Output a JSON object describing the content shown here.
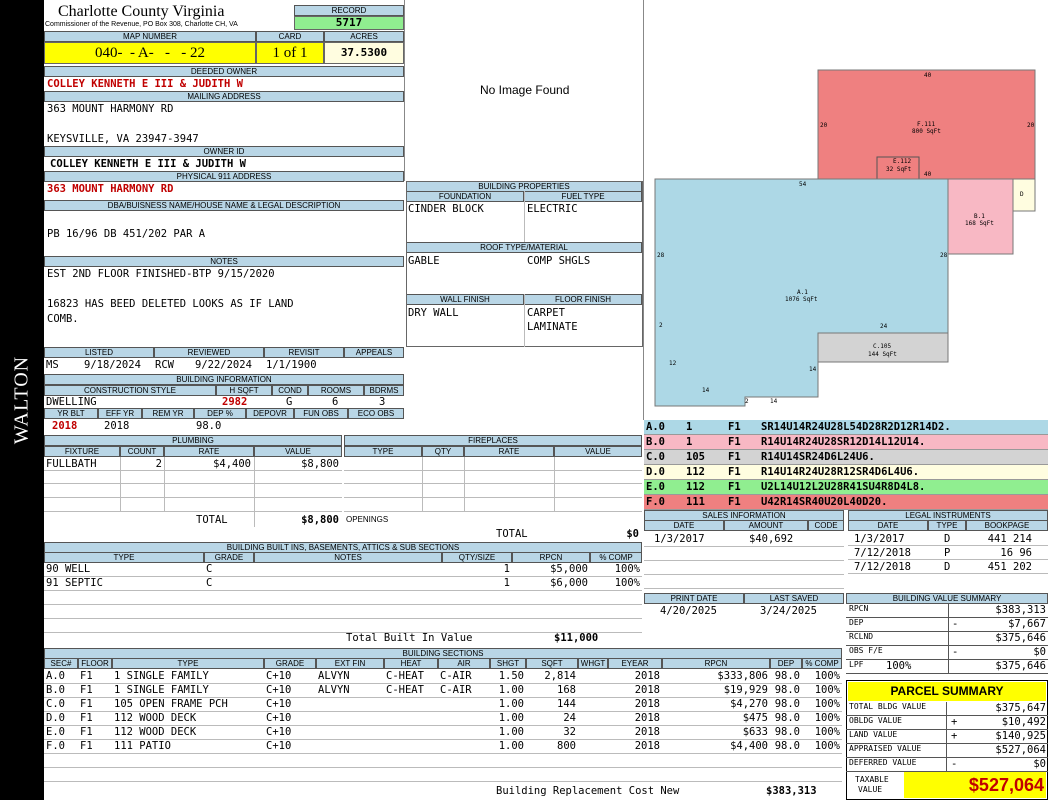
{
  "side_label": "WALTON",
  "header": {
    "county": "Charlotte County Virginia",
    "commissioner": "Commissioner of the Revenue, PO Box 308, Charlotte CH, VA",
    "record_label": "RECORD",
    "record": "5717",
    "map_label": "MAP NUMBER",
    "map_number": "040-  - A-   -   - 22",
    "card_label": "CARD",
    "card": "1 of 1",
    "acres_label": "ACRES",
    "acres": "37.5300"
  },
  "owner": {
    "deeded_label": "DEEDED OWNER",
    "deeded": "COLLEY KENNETH E III & JUDITH W",
    "mailing_label": "MAILING ADDRESS",
    "mail1": "363 MOUNT HARMONY RD",
    "mail2": "KEYSVILLE, VA 23947-3947",
    "owner_id_label": "OWNER ID",
    "owner_id": "COLLEY KENNETH E III & JUDITH W",
    "physical_label": "PHYSICAL 911 ADDRESS",
    "physical": "363 MOUNT HARMONY RD"
  },
  "dba": {
    "label": "DBA/BUISNESS NAME/HOUSE NAME & LEGAL DESCRIPTION",
    "text": "PB 16/96 DB 451/202 PAR A"
  },
  "notes": {
    "label": "NOTES",
    "line1": "EST 2ND FLOOR FINISHED-BTP 9/15/2020",
    "line2": "16823 HAS BEED DELETED LOOKS AS IF LAND",
    "line3": "COMB."
  },
  "listing": {
    "listed_label": "LISTED",
    "reviewed_label": "REVIEWED",
    "revisit_label": "REVISIT",
    "appeals_label": "APPEALS",
    "listed_by": "MS",
    "listed": "9/18/2024",
    "reviewed_by": "RCW",
    "reviewed": "9/22/2024",
    "revisit": "1/1/1900"
  },
  "bldg_info": {
    "label": "BUILDING INFORMATION",
    "cs_label": "CONSTRUCTION STYLE",
    "hsqft_label": "H SQFT",
    "cond_label": "COND",
    "rooms_label": "ROOMS",
    "bdrms_label": "BDRMS",
    "style": "DWELLING",
    "hsqft": "2982",
    "cond": "G",
    "rooms": "6",
    "bdrms": "3",
    "yrblt_label": "YR BLT",
    "effyr_label": "EFF YR",
    "remyr_label": "REM YR",
    "dep_label": "DEP %",
    "depovr_label": "DEPOVR",
    "funobs_label": "FUN OBS",
    "ecoobs_label": "ECO OBS",
    "yrblt": "2018",
    "effyr": "2018",
    "dep": "98.0"
  },
  "image": {
    "text": "No Image Found"
  },
  "bldg_props": {
    "label": "BUILDING PROPERTIES",
    "foundation_label": "FOUNDATION",
    "fuel_label": "FUEL TYPE",
    "foundation": "CINDER BLOCK",
    "fuel": "ELECTRIC",
    "roof_label": "ROOF TYPE/MATERIAL",
    "roof_type": "GABLE",
    "roof_mat": "COMP SHGLS",
    "wall_label": "WALL FINISH",
    "floor_label": "FLOOR FINISH",
    "wall": "DRY WALL",
    "floor1": "CARPET",
    "floor2": "LAMINATE"
  },
  "plumbing": {
    "label": "PLUMBING",
    "h_fixture": "FIXTURE",
    "h_count": "COUNT",
    "h_rate": "RATE",
    "h_value": "VALUE",
    "fixture": "FULLBATH",
    "count": "2",
    "rate": "$4,400",
    "value": "$8,800",
    "total_label": "TOTAL",
    "total": "$8,800"
  },
  "fireplaces": {
    "label": "FIREPLACES",
    "h_type": "TYPE",
    "h_qty": "QTY",
    "h_rate": "RATE",
    "h_value": "VALUE",
    "openings": "OPENINGS",
    "total_label": "TOTAL",
    "total": "$0"
  },
  "builtins": {
    "label": "BUILDING BUILT INS, BASEMENTS, ATTICS & SUB SECTIONS",
    "h_type": "TYPE",
    "h_grade": "GRADE",
    "h_notes": "NOTES",
    "h_qty": "QTY/SIZE",
    "h_rpcn": "RPCN",
    "h_comp": "% COMP",
    "rows": [
      {
        "type": "90 WELL",
        "notes": "C",
        "qty": "1",
        "rpcn": "$5,000",
        "comp": "100%"
      },
      {
        "type": "91 SEPTIC",
        "notes": "C",
        "qty": "1",
        "rpcn": "$6,000",
        "comp": "100%"
      }
    ],
    "total_label": "Total Built In Value",
    "total": "$11,000"
  },
  "sections": {
    "label": "BUILDING SECTIONS",
    "headers": [
      "SEC#",
      "FLOOR",
      "TYPE",
      "GRADE",
      "EXT FIN",
      "HEAT",
      "AIR",
      "SHGT",
      "SQFT",
      "WHGT",
      "EYEAR",
      "RPCN",
      "DEP",
      "% COMP"
    ],
    "rows": [
      [
        "A.0",
        "F1",
        "1 SINGLE FAMILY",
        "C+10",
        "ALVYN",
        "C-HEAT",
        "C-AIR",
        "1.50",
        "2,814",
        "",
        "2018",
        "$333,806",
        "98.0",
        "100%"
      ],
      [
        "B.0",
        "F1",
        "1 SINGLE FAMILY",
        "C+10",
        "ALVYN",
        "C-HEAT",
        "C-AIR",
        "1.00",
        "168",
        "",
        "2018",
        "$19,929",
        "98.0",
        "100%"
      ],
      [
        "C.0",
        "F1",
        "105 OPEN FRAME PCH",
        "C+10",
        "",
        "",
        "",
        "1.00",
        "144",
        "",
        "2018",
        "$4,270",
        "98.0",
        "100%"
      ],
      [
        "D.0",
        "F1",
        "112 WOOD DECK",
        "C+10",
        "",
        "",
        "",
        "1.00",
        "24",
        "",
        "2018",
        "$475",
        "98.0",
        "100%"
      ],
      [
        "E.0",
        "F1",
        "112 WOOD DECK",
        "C+10",
        "",
        "",
        "",
        "1.00",
        "32",
        "",
        "2018",
        "$633",
        "98.0",
        "100%"
      ],
      [
        "F.0",
        "F1",
        "111 PATIO",
        "C+10",
        "",
        "",
        "",
        "1.00",
        "800",
        "",
        "2018",
        "$4,400",
        "98.0",
        "100%"
      ]
    ],
    "total_label": "Building Replacement Cost New",
    "total": "$383,313"
  },
  "sketch": {
    "f_label": "F.111",
    "f_area": "800 SqFt",
    "e_label": "E.112",
    "e_area": "32 SqFt",
    "b_label": "B.1",
    "b_area": "168 SqFt",
    "a_label": "A.1",
    "a_area": "1076 SqFt",
    "c_label": "C.105",
    "c_area": "144 SqFt",
    "d_label": "D",
    "dims": [
      "40",
      "20",
      "20",
      "40",
      "54",
      "28",
      "28",
      "2",
      "24",
      "12",
      "14",
      "14",
      "2",
      "14"
    ],
    "colors": {
      "f": "#ef8080",
      "b": "#f8b8c4",
      "a": "#add8e6",
      "c": "#d3d3d3",
      "d": "#fffde0"
    }
  },
  "vectors": [
    {
      "sec": "A.0",
      "code": "1",
      "fl": "F1",
      "path": "SR14U14R24U28L54D28R2D12R14D2.",
      "color": "#add8e6"
    },
    {
      "sec": "B.0",
      "code": "1",
      "fl": "F1",
      "path": "R14U14R24U28SR12D14L12U14.",
      "color": "#f8b8c4"
    },
    {
      "sec": "C.0",
      "code": "105",
      "fl": "F1",
      "path": "R14U14SR24D6L24U6.",
      "color": "#d3d3d3"
    },
    {
      "sec": "D.0",
      "code": "112",
      "fl": "F1",
      "path": "R14U14R24U28R12SR4D6L4U6.",
      "color": "#fffde0"
    },
    {
      "sec": "E.0",
      "code": "112",
      "fl": "F1",
      "path": "U2L14U12L2U28R41SU4R8D4L8.",
      "color": "#90ee90"
    },
    {
      "sec": "F.0",
      "code": "111",
      "fl": "F1",
      "path": "U42R14SR40U20L40D20.",
      "color": "#ef8080"
    }
  ],
  "sales": {
    "label": "SALES INFORMATION",
    "h_date": "DATE",
    "h_amount": "AMOUNT",
    "h_code": "CODE",
    "date": "1/3/2017",
    "amount": "$40,692"
  },
  "legal": {
    "label": "LEGAL INSTRUMENTS",
    "h_date": "DATE",
    "h_type": "TYPE",
    "h_book": "BOOKPAGE",
    "rows": [
      [
        "1/3/2017",
        "D",
        "441 214"
      ],
      [
        "7/12/2018",
        "P",
        "16 96"
      ],
      [
        "7/12/2018",
        "D",
        "451 202"
      ]
    ]
  },
  "print": {
    "print_label": "PRINT DATE",
    "saved_label": "LAST SAVED",
    "print_date": "4/20/2025",
    "saved": "3/24/2025"
  },
  "bvs": {
    "label": "BUILDING VALUE SUMMARY",
    "rows": [
      [
        "RPCN",
        "",
        "$383,313"
      ],
      [
        "DEP",
        "-",
        "$7,667"
      ],
      [
        "RCLND",
        "",
        "$375,646"
      ],
      [
        "OBS F/E",
        "-",
        "$0"
      ],
      [
        "LPF",
        "100%",
        "$375,646"
      ]
    ]
  },
  "parcel": {
    "label": "PARCEL SUMMARY",
    "rows": [
      [
        "TOTAL BLDG VALUE",
        "",
        "$375,647"
      ],
      [
        "OBLDG VALUE",
        "+",
        "$10,492"
      ],
      [
        "LAND VALUE",
        "+",
        "$140,925"
      ],
      [
        "APPRAISED VALUE",
        "",
        "$527,064"
      ],
      [
        "DEFERRED VALUE",
        "-",
        "$0"
      ]
    ],
    "taxable_label1": "TAXABLE",
    "taxable_label2": "VALUE",
    "taxable": "$527,064"
  }
}
